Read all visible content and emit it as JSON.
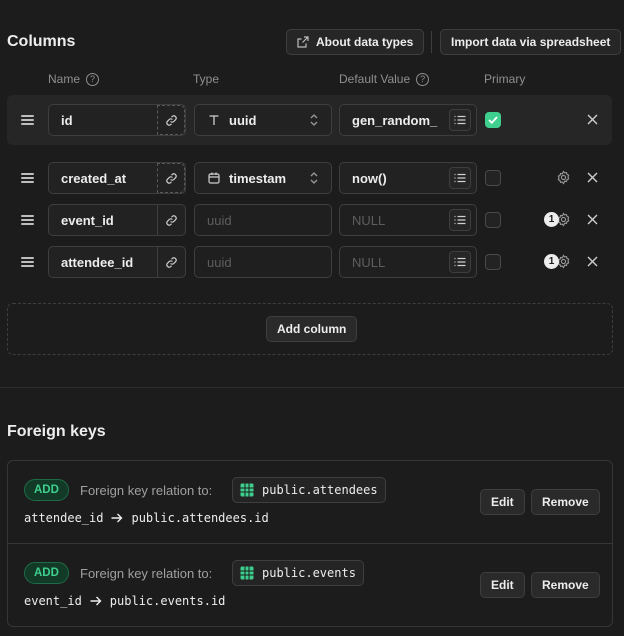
{
  "header": {
    "title": "Columns",
    "about_label": "About data types",
    "import_label": "Import data via spreadsheet"
  },
  "column_headers": {
    "name": "Name",
    "type": "Type",
    "default": "Default Value",
    "primary": "Primary"
  },
  "columns": [
    {
      "name": "id",
      "type": "uuid",
      "default": "gen_random_",
      "primary": true
    },
    {
      "name": "created_at",
      "type": "timestam",
      "default": "now()",
      "primary": false
    },
    {
      "name": "event_id",
      "type": "uuid",
      "default": "NULL",
      "primary": false,
      "badge": "1"
    },
    {
      "name": "attendee_id",
      "type": "uuid",
      "default": "NULL",
      "primary": false,
      "badge": "1"
    }
  ],
  "add_column_label": "Add column",
  "foreign_keys": {
    "title": "Foreign keys",
    "items": [
      {
        "tag": "ADD",
        "label": "Foreign key relation to:",
        "table": "public.attendees",
        "from": "attendee_id",
        "to": "public.attendees.id",
        "edit": "Edit",
        "remove": "Remove"
      },
      {
        "tag": "ADD",
        "label": "Foreign key relation to:",
        "table": "public.events",
        "from": "event_id",
        "to": "public.events.id",
        "edit": "Edit",
        "remove": "Remove"
      }
    ]
  },
  "colors": {
    "background": "#1c1c1c",
    "accent": "#3ecf8e",
    "border": "#3e3e3e"
  }
}
